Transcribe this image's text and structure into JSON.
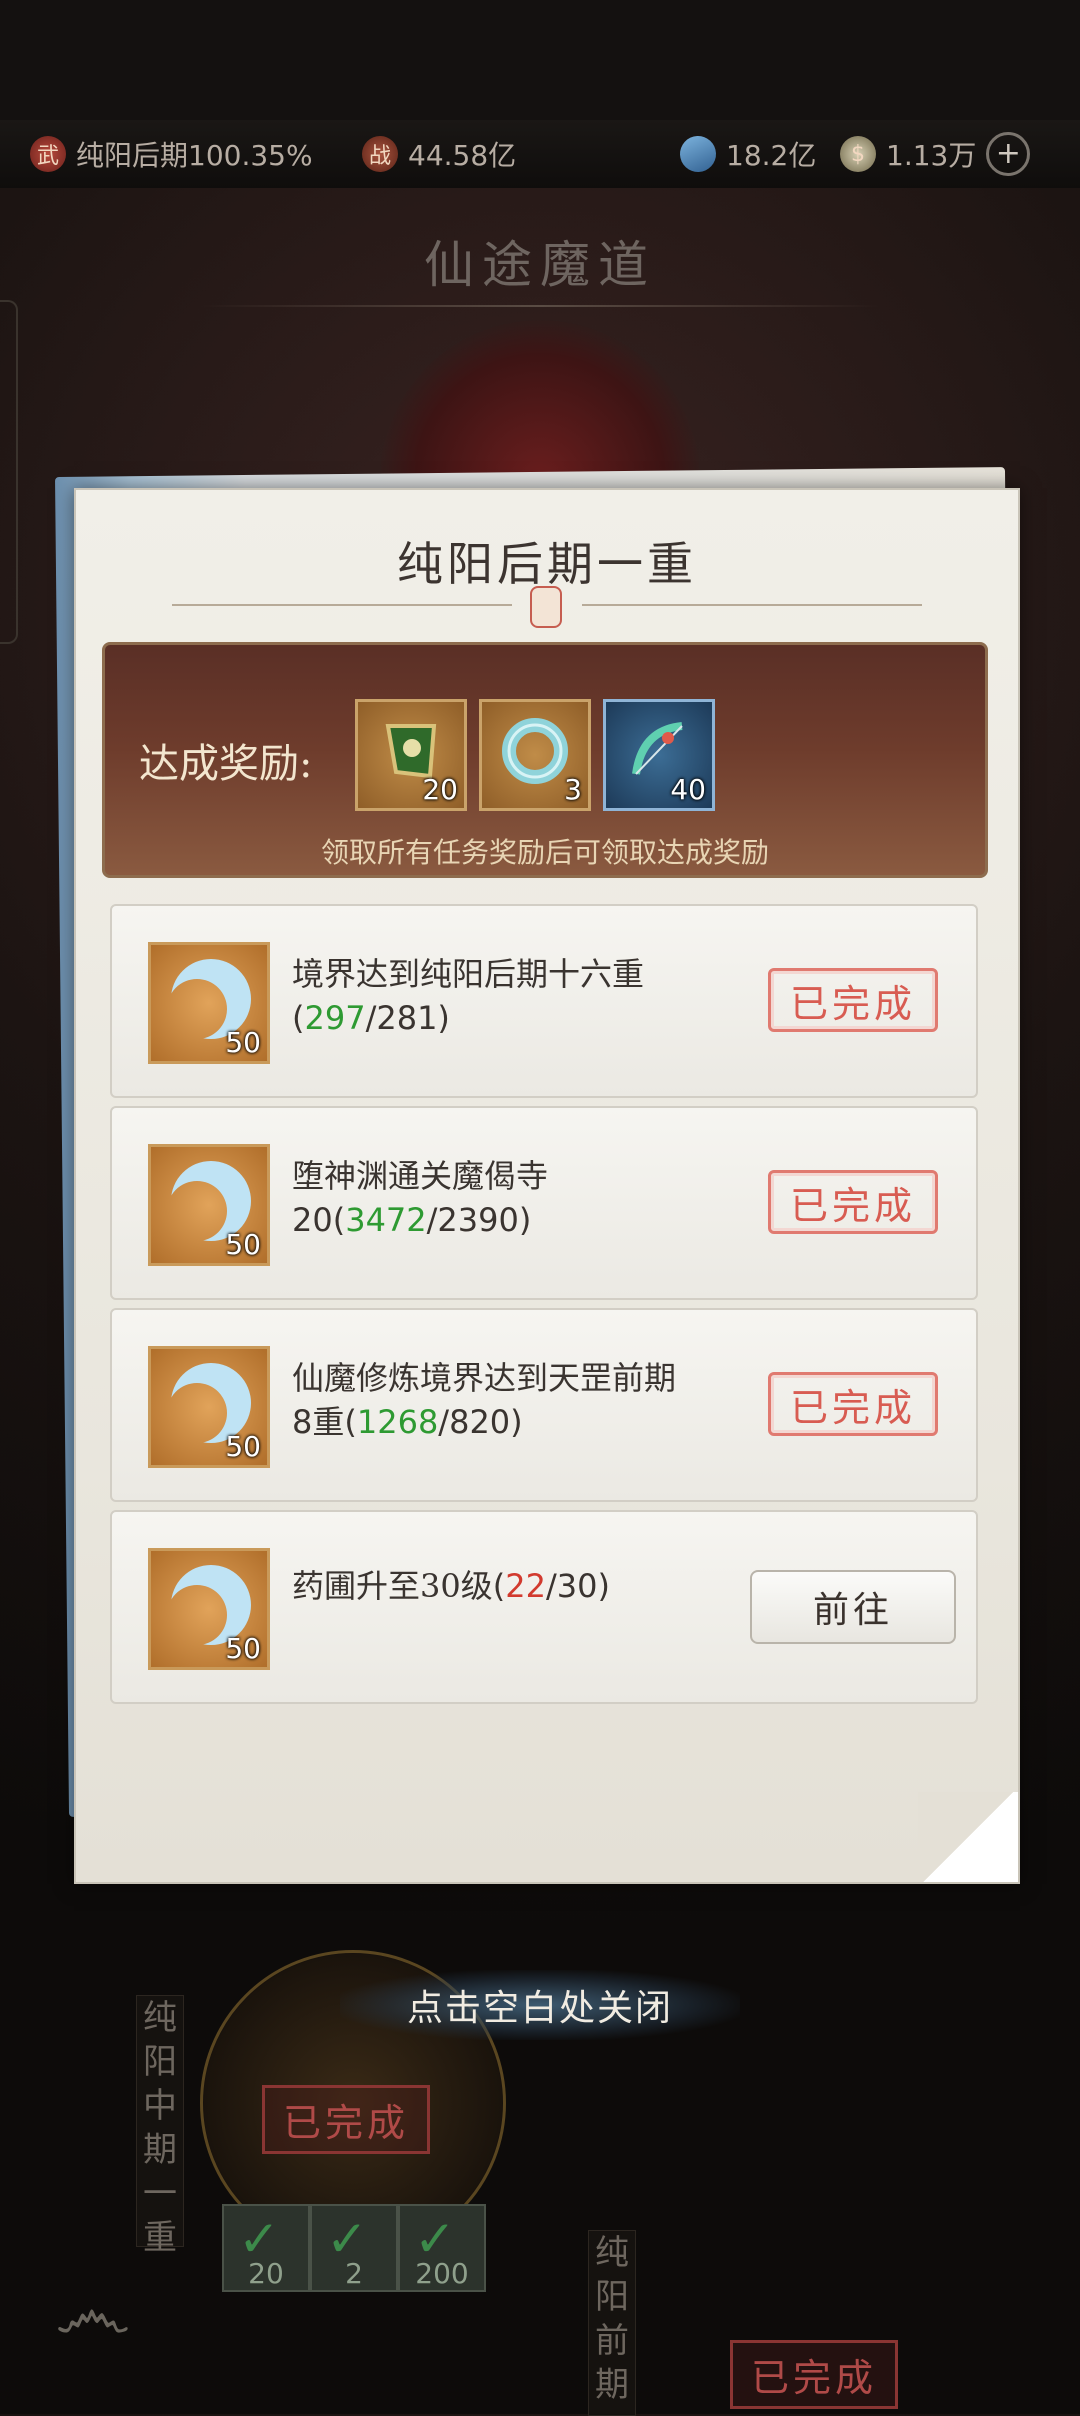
{
  "status": {
    "realm_label": "纯阳后期100.35%",
    "power": "44.58亿",
    "crystal": "18.2亿",
    "coins": "1.13万",
    "realm_icon": "武",
    "power_icon": "战",
    "add_icon": "plus-icon"
  },
  "background": {
    "title": "仙途魔道",
    "left_stage_label": "纯阳中期一重",
    "left_stage_done": "已完成",
    "left_stage_rewards": [
      "20",
      "2",
      "200"
    ],
    "right_stage_label": "纯阳前期",
    "right_stage_done": "已完成"
  },
  "dialog": {
    "title": "纯阳后期一重",
    "reward_label": "达成奖励:",
    "rewards": [
      {
        "count": "20",
        "icon": "green-banner-item"
      },
      {
        "count": "3",
        "icon": "jade-ring-item"
      },
      {
        "count": "40",
        "icon": "bow-item"
      }
    ],
    "reward_hint": "领取所有任务奖励后可领取达成奖励",
    "tasks": [
      {
        "desc": "境界达到纯阳后期十六重",
        "prefix": "",
        "cur": "297",
        "total": "281",
        "reward": "50",
        "status": "已完成"
      },
      {
        "desc": "堕神渊通关魔偈寺",
        "prefix": "20",
        "cur": "3472",
        "total": "2390",
        "reward": "50",
        "status": "已完成"
      },
      {
        "desc": "仙魔修炼境界达到天罡前期",
        "prefix": "8重",
        "cur": "1268",
        "total": "820",
        "reward": "50",
        "status": "已完成"
      },
      {
        "desc": "药圃升至30级",
        "prefix": "",
        "cur": "22",
        "total": "30",
        "reward": "50",
        "status": "前往"
      }
    ]
  },
  "close_hint": "点击空白处关闭"
}
